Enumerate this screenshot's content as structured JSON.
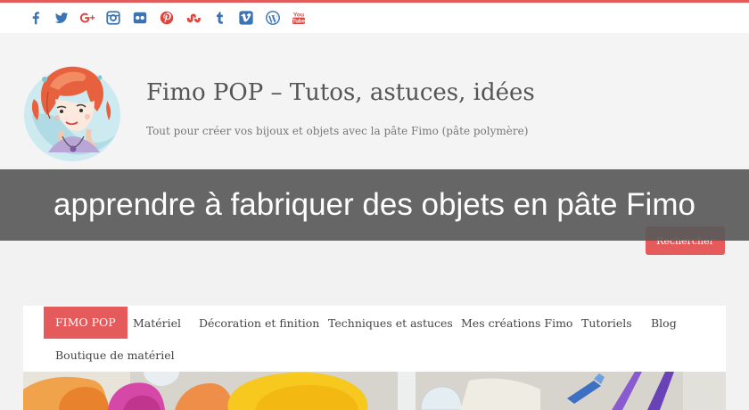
{
  "social": {
    "icons": [
      "facebook-icon",
      "twitter-icon",
      "google-plus-icon",
      "instagram-icon",
      "flickr-icon",
      "pinterest-icon",
      "stumbleupon-icon",
      "tumblr-icon",
      "vimeo-icon",
      "wordpress-icon",
      "youtube-icon"
    ]
  },
  "site": {
    "title": "Fimo POP – Tutos, astuces, idées",
    "tagline": "Tout pour créer vos bijoux et objets avec la pâte Fimo (pâte polymère)"
  },
  "banner": {
    "text": "apprendre à fabriquer des objets en pâte Fimo"
  },
  "search": {
    "button_label": "Rechercher"
  },
  "nav": {
    "items": [
      {
        "label": "FIMO POP",
        "active": true
      },
      {
        "label": "Matériel"
      },
      {
        "label": "Décoration et finition"
      },
      {
        "label": "Techniques et astuces"
      },
      {
        "label": "Mes créations Fimo"
      },
      {
        "label": "Tutoriels"
      },
      {
        "label": "Blog"
      },
      {
        "label": "Boutique de matériel"
      }
    ]
  },
  "colors": {
    "accent": "#e55a5a",
    "social_blue": "#3b73b3",
    "social_red": "#d9473f",
    "banner_overlay": "#5a5a5a"
  }
}
